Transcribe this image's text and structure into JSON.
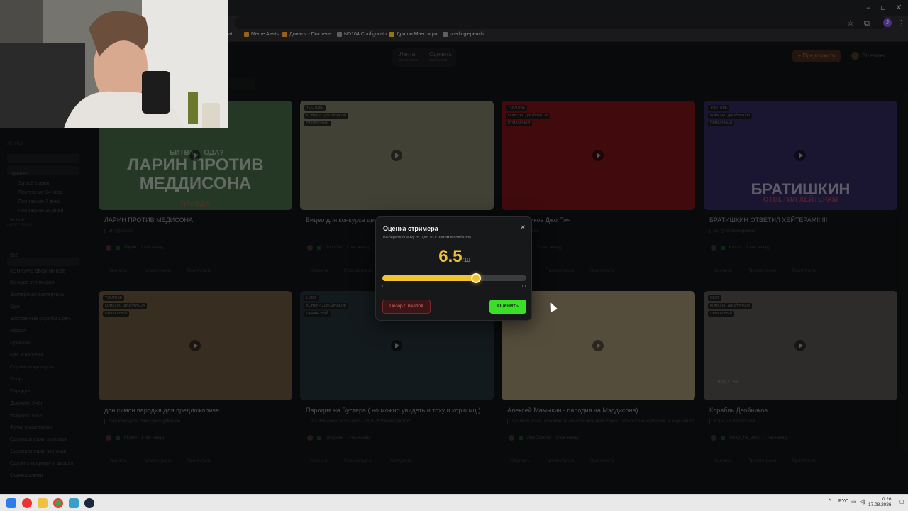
{
  "bookmarks": [
    {
      "label": "nat",
      "color": "#888888"
    },
    {
      "label": "Meme Alerts",
      "color": "#f0a020"
    },
    {
      "label": "Донаты - Последн...",
      "color": "#f0a020"
    },
    {
      "label": "ND104 Configurator",
      "color": "#aaaaaa"
    },
    {
      "label": "Драгон Мэнс игра...",
      "color": "#e8c020"
    },
    {
      "label": "predlogiepeach",
      "color": "#aaaaaa"
    }
  ],
  "browser": {
    "account_initial": "J"
  },
  "header": {
    "tab_feed": "Лента",
    "tab_feed_sub": "для стрима",
    "tab_rate": "Оценить",
    "tab_rate_sub": "ваш выбор",
    "suggest_label": "+ Предложить",
    "user_name": "Streamer"
  },
  "sidebar": {
    "items": [
      "Собрание фото",
      "Лучшее",
      "За всё время",
      "Последние 24 часа",
      "Последние 7 дней",
      "Последние 30 дней",
      "Новое",
      "Всё",
      "КОНКУРС ДВОЙНИКОВ",
      "Конкурс стримеров",
      "Экспертная экспертиза",
      "Срач",
      "Экстренные службы Срач",
      "Россия",
      "Приколы",
      "Еда и напитки",
      "Страны и культуры",
      "Спорт",
      "Пародии",
      "ДокументУчёт",
      "Нейросеточки",
      "Фотки в картинках",
      "Оценка внешки мужская",
      "Оценка внешки женская",
      "Оценить квартиру и дизайн",
      "Оценка шапки"
    ],
    "heads": [
      "Ленты",
      "Категории"
    ]
  },
  "cards": [
    {
      "title": "ЛАРИН ПРОТИВ МЕДИСОНА",
      "desc": "By @vasiall",
      "author": "Ларин",
      "time": "1 час назад",
      "tags": [],
      "thumb_text": "ЛАРИН ПРОТИВ МЕДДИСОНА",
      "thumb_top": "БИТВА ... ОДА?",
      "thumb_bottom": "ПРАВДА",
      "color": "#3d5a3c"
    },
    {
      "title": "Видео для конкурса дво...",
      "desc": "",
      "author": "Коробок",
      "time": "1 час назад",
      "tags": [
        "YOUTUBE",
        "КОНКУРС ДВОЙНИКОВ",
        "ПРИКАТНЫЙ"
      ],
      "color": "#6b6a58"
    },
    {
      "title": "...двойников Джо Пич",
      "desc": "...000андрей",
      "author": "Кто",
      "time": "1 час назад",
      "tags": [
        "YOUTUBE",
        "КОНКУРС ДВОЙНИКОВ",
        "ПРИКАТНЫЙ"
      ],
      "color": "#6a1216"
    },
    {
      "title": "БРАТИШКИН ОТВЕТИЛ ХЕЙТЕРАМ!!!!!!",
      "desc": "by @ronuchegonixe",
      "author": "Кто-то",
      "time": "1 час назад",
      "tags": [
        "YOUTUBE",
        "КОНКУРС ДВОЙНИКОВ",
        "ПРИКАТНЫЙ"
      ],
      "thumb_text": "БРАТИШКИН",
      "thumb_bottom": "ОТВЕТИЛ ХЕЙТЕРАМ",
      "color": "#2b2450"
    },
    {
      "title": "дон симон пародия для предложопича",
      "desc": "для конкурса, для сарки @Mозон",
      "author": "Мозон",
      "time": "1 час назад",
      "tags": [
        "YOUTUBE",
        "КОНКУРС ДВОЙНИКОВ",
        "ПРИКАТНЫЙ"
      ],
      "color": "#5a4a34"
    },
    {
      "title": "Пародия на Бустера ( но можно увидеть и тоху и корю мц )",
      "desc": "тг для связи если что - https://t.me/Marganpxo",
      "author": "Margane",
      "time": "1 час назад",
      "tags": [
        "LOCK",
        "КОНКУРС ДВОЙНИКОВ",
        "ПРИКАТНЫЙ"
      ],
      "color": "#1f2a30"
    },
    {
      "title": "Алексей Мамыкин - пародия на Мэддисона)",
      "desc": "Привет Илья, спасибо за счастливое детство и спокойствие разума, а ещё найти парня, но не нашёл, xD",
      "author": "AlexDMaster",
      "time": "1 час назад",
      "tags": [],
      "color": "#8a7c62"
    },
    {
      "title": "Корабль Двойников",
      "desc": "Юра <3 Just for lulz",
      "author": "Swag_the_alien",
      "time": "1 час назад",
      "tags": [
        "BEST",
        "КОНКУРС ДВОЙНИКОВ",
        "ПРИКАТНЫЙ"
      ],
      "time_code": "0:00 / 1:58",
      "color": "#4a4844"
    }
  ],
  "card_actions": [
    "Оценить",
    "Просмотрено",
    "Пропустить"
  ],
  "modal": {
    "title": "Оценка стримера",
    "subtitle": "Выберите оценку от 0 до 10 с шагом в полбалла",
    "close_icon": "×",
    "score": "6.5",
    "score_max": "/10",
    "score_value": 6.5,
    "range_min": 0,
    "range_max": 10,
    "tick_min": "0",
    "tick_max": "10",
    "shame_label": "Позор 0 баллов",
    "rate_label": "Оценить",
    "accent": "#f1c232",
    "rate_color": "#39e026",
    "shame_color": "#e07070"
  },
  "taskbar": {
    "lang": "РУС",
    "time": "0:26",
    "date": "17.08.2026"
  }
}
